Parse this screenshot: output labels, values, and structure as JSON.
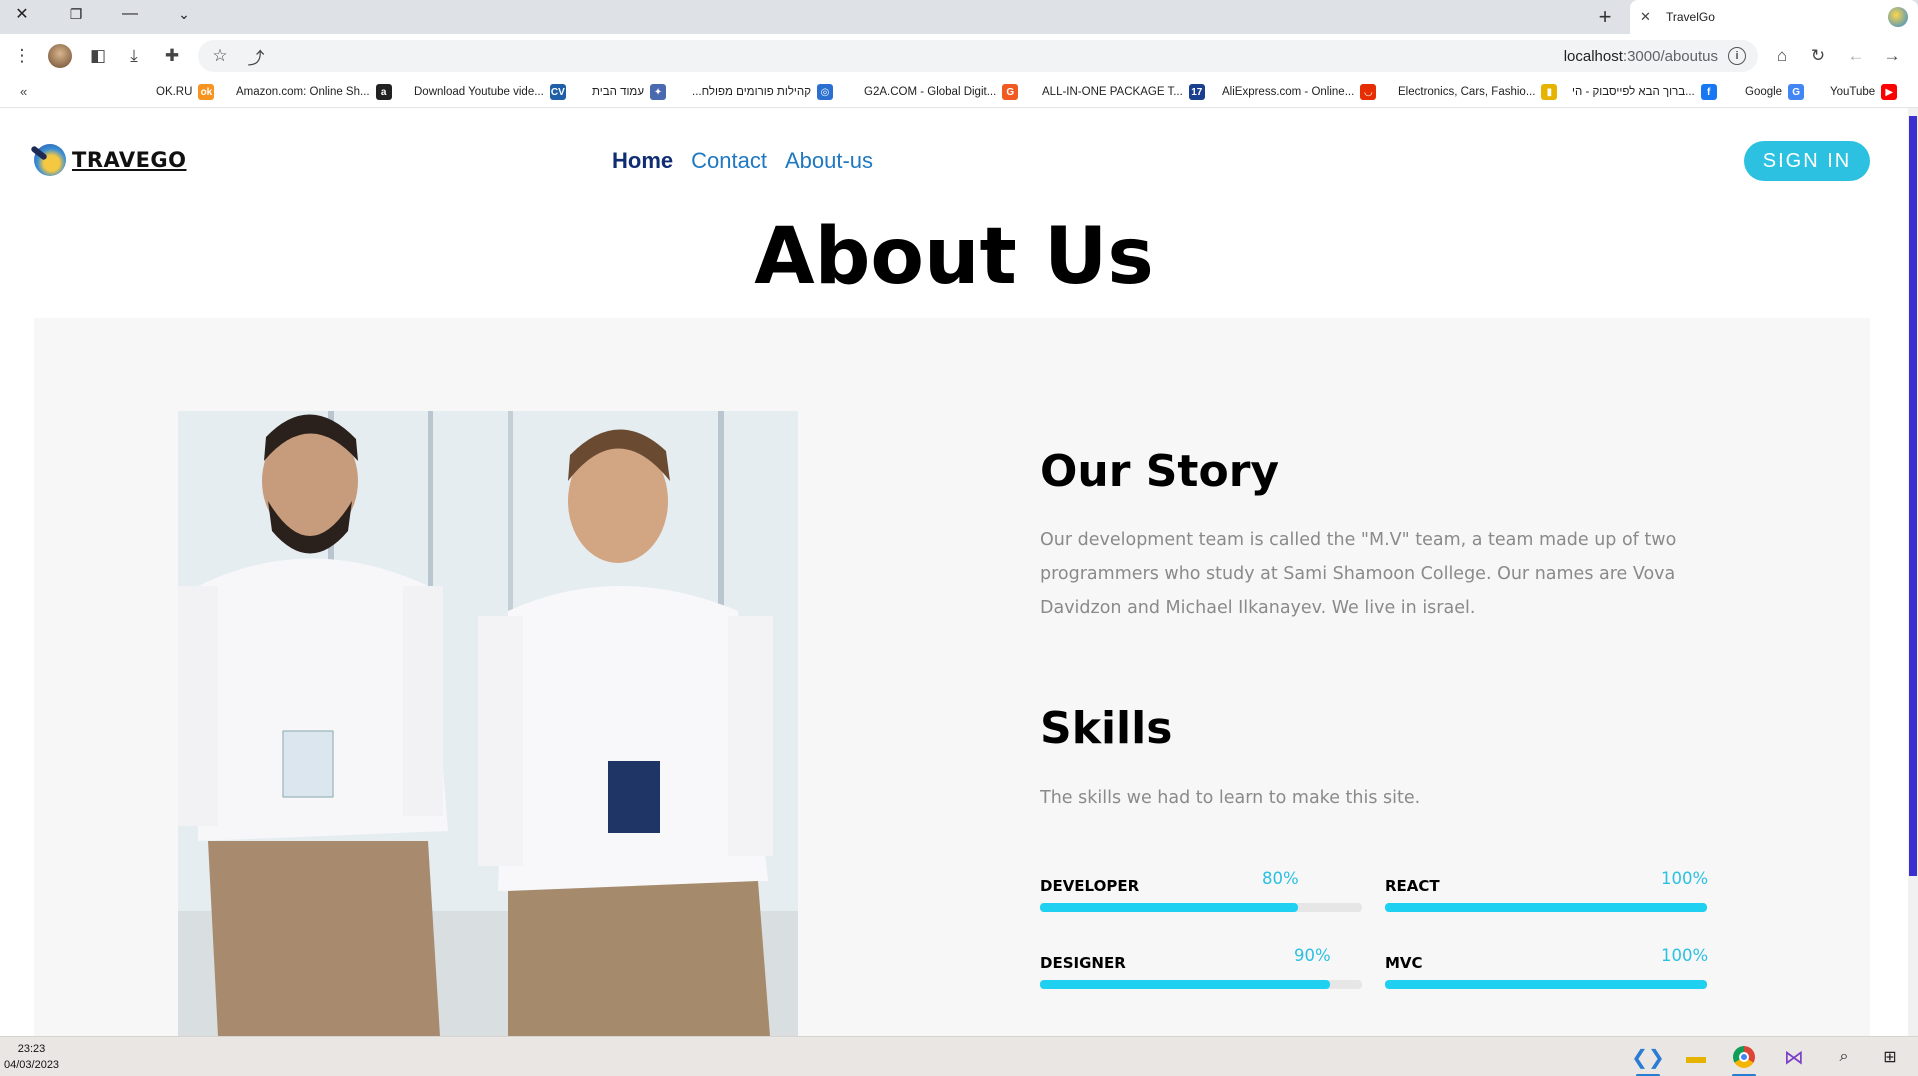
{
  "browser": {
    "tab_title": "TravelGo",
    "new_tab_glyph": "+",
    "url_host": "localhost",
    "url_path": ":3000/aboutus",
    "bookmarks": [
      {
        "label": "OK.RU",
        "icon": "ok-icon",
        "color": "#f7931e",
        "glyph": "ok"
      },
      {
        "label": "Amazon.com: Online Sh...",
        "icon": "amazon-icon",
        "color": "#222222",
        "glyph": "a"
      },
      {
        "label": "Download Youtube vide...",
        "icon": "cv-icon",
        "color": "#1e5fa8",
        "glyph": "CV"
      },
      {
        "label": "עמוד הבית",
        "icon": "star-sparkle-icon",
        "color": "#4a6ab0",
        "glyph": "✦"
      },
      {
        "label": "...קהילות פורומים מפולח",
        "icon": "globe-badge-icon",
        "color": "#2b6fd1",
        "glyph": "◎"
      },
      {
        "label": "G2A.COM - Global Digit...",
        "icon": "g2a-icon",
        "color": "#f05a22",
        "glyph": "G"
      },
      {
        "label": "ALL-IN-ONE PACKAGE T...",
        "icon": "seventeen-icon",
        "color": "#1b3f8f",
        "glyph": "17"
      },
      {
        "label": "AliExpress.com - Online...",
        "icon": "aliexpress-icon",
        "color": "#e62e04",
        "glyph": "◡"
      },
      {
        "label": "Electronics, Cars, Fashio...",
        "icon": "ebay-bag-icon",
        "color": "#e6b400",
        "glyph": "▮"
      },
      {
        "label": "ברוך הבא לפייסבוק - הי...",
        "icon": "facebook-icon",
        "color": "#1877f2",
        "glyph": "f"
      },
      {
        "label": "Google",
        "icon": "google-icon",
        "color": "#4285f4",
        "glyph": "G"
      },
      {
        "label": "YouTube",
        "icon": "youtube-icon",
        "color": "#ff0000",
        "glyph": "▶"
      }
    ]
  },
  "site": {
    "brand": "TRAVEGO",
    "nav": [
      {
        "label": "Home",
        "active": true
      },
      {
        "label": "Contact",
        "active": false
      },
      {
        "label": "About-us",
        "active": false
      }
    ],
    "sign_in": "SIGN IN",
    "heading": "About Us"
  },
  "story": {
    "title": "Our Story",
    "text": "Our development team is called the \"M.V\" team, a team made up of two programmers who study at Sami Shamoon College. Our names are Vova Davidzon and Michael Ilkanayev. We live in israel."
  },
  "skills": {
    "title": "Skills",
    "subtitle": "The skills we had to learn to make this site.",
    "items": [
      {
        "name": "DEVELOPER",
        "percent_label": "80%",
        "value": 80
      },
      {
        "name": "REACT",
        "percent_label": "100%",
        "value": 100
      },
      {
        "name": "DESIGNER",
        "percent_label": "90%",
        "value": 90
      },
      {
        "name": "MVC",
        "percent_label": "100%",
        "value": 100
      }
    ]
  },
  "colors": {
    "accent": "#2cc1e0",
    "bar_fill": "#1fd0f0",
    "nav_link": "#1f78c0",
    "nav_active": "#0f2d73",
    "scroll_thumb": "#3b2fd0"
  },
  "taskbar": {
    "time": "23:23",
    "date": "04/03/2023",
    "apps": [
      "vscode-icon",
      "file-explorer-icon",
      "chrome-icon",
      "visual-studio-icon",
      "search-icon",
      "windows-start-icon"
    ]
  }
}
